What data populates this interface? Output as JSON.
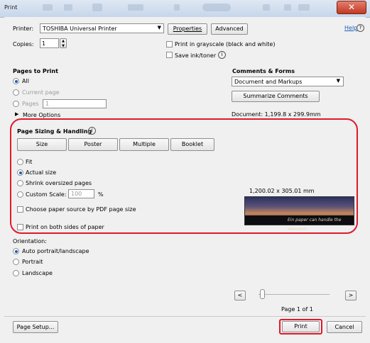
{
  "window": {
    "title": "Print",
    "close_glyph": "✕"
  },
  "printer": {
    "label": "Printer:",
    "value": "TOSHIBA Universal Printer",
    "properties_label": "Properties",
    "advanced_label": "Advanced",
    "help_label": "Help"
  },
  "copies": {
    "label": "Copies:",
    "value": "1"
  },
  "options": {
    "grayscale_label": "Print in grayscale (black and white)",
    "save_ink_label": "Save ink/toner"
  },
  "pages_to_print": {
    "heading": "Pages to Print",
    "all_label": "All",
    "current_page_label": "Current page",
    "pages_label": "Pages",
    "pages_value": "1",
    "more_options_label": "More Options"
  },
  "comments_forms": {
    "heading": "Comments & Forms",
    "value": "Document and Markups",
    "summarize_label": "Summarize Comments"
  },
  "document_size": "Document: 1,199.8 x 299.9mm",
  "page_sizing": {
    "heading": "Page Sizing & Handling",
    "tabs": [
      "Size",
      "Poster",
      "Multiple",
      "Booklet"
    ],
    "fit_label": "Fit",
    "actual_size_label": "Actual size",
    "shrink_label": "Shrink oversized pages",
    "custom_scale_label": "Custom Scale:",
    "custom_scale_value": "100",
    "percent": "%",
    "paper_source_label": "Choose paper source by PDF page size",
    "both_sides_label": "Print on both sides of paper"
  },
  "preview": {
    "size": "1,200.02 x 305.01 mm",
    "banner_text": "Ein paper can handle the elements"
  },
  "orientation": {
    "heading": "Orientation:",
    "auto_label": "Auto portrait/landscape",
    "portrait_label": "Portrait",
    "landscape_label": "Landscape"
  },
  "pager": {
    "prev": "<",
    "next": ">",
    "label": "Page 1 of 1"
  },
  "footer": {
    "page_setup_label": "Page Setup...",
    "print_label": "Print",
    "cancel_label": "Cancel"
  },
  "colors": {
    "highlight": "#e0192a",
    "link": "#1a5fb4"
  },
  "icons": [
    "help-icon",
    "info-icon",
    "dropdown-arrow-icon",
    "spin-arrows-icon",
    "triangle-right-icon",
    "close-icon"
  ]
}
